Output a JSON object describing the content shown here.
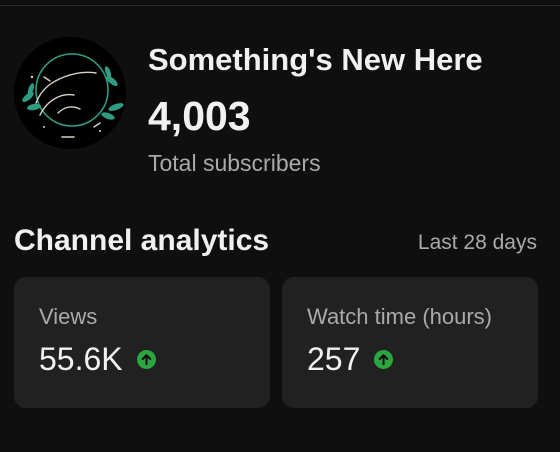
{
  "channel": {
    "name": "Something's New Here",
    "subscriber_count": "4,003",
    "subscriber_label": "Total subscribers",
    "avatar_icon": "channel-logo-wreath"
  },
  "analytics": {
    "title": "Channel analytics",
    "period": "Last 28 days",
    "cards": [
      {
        "label": "Views",
        "value": "55.6K",
        "trend": "up",
        "trend_icon": "arrow-up-circle-icon"
      },
      {
        "label": "Watch time (hours)",
        "value": "257",
        "trend": "up",
        "trend_icon": "arrow-up-circle-icon"
      }
    ]
  },
  "colors": {
    "background": "#0f0f0f",
    "card": "#212121",
    "primary_text": "#f1f1f1",
    "secondary_text": "#aaaaaa",
    "trend_up": "#2ba640",
    "logo_script": "#d9d2c5",
    "logo_leaves": "#2e9b82"
  }
}
